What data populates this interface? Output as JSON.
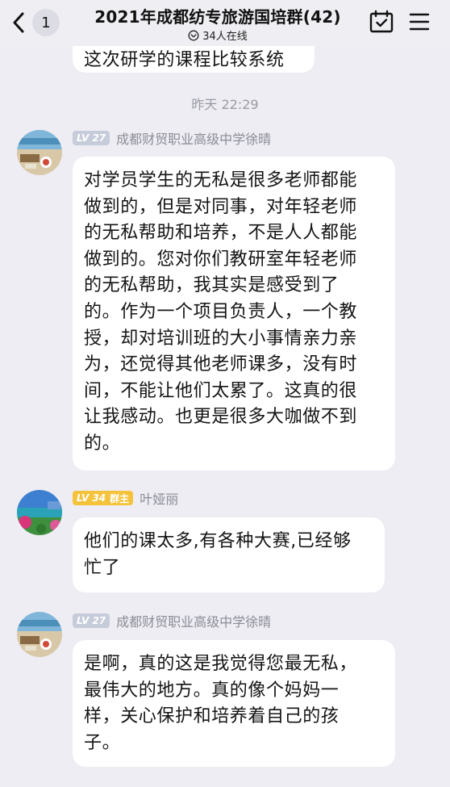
{
  "header": {
    "title": "2021年成都纺专旅游国培群(42)",
    "back_badge": "1",
    "online_text": "34人在线"
  },
  "partial_message": "这次研学的课程比较系统",
  "timestamp": "昨天 22:29",
  "messages": [
    {
      "level": "LV 27",
      "role": "",
      "sender": "成都财贸职业高级中学徐晴",
      "lines": [
        "对学员学生的无私是很多老师都能",
        "做到的，但是对同事，对年轻老师",
        "的无私帮助和培养，不是人人都能",
        "做到的。您对你们教研室年轻老师",
        "的无私帮助，我其实是感受到了",
        "的。作为一个项目负责人，一个教",
        "授，却对培训班的大小事情亲力亲",
        "为，还觉得其他老师课多，没有时",
        "间，不能让他们太累了。这真的很",
        "让我感动。也更是很多大咖做不到",
        "的。"
      ]
    },
    {
      "level": "LV 34",
      "role": "群主",
      "sender": "叶娅丽",
      "lines": [
        "他们的课太多,有各种大赛,已经够",
        "忙了"
      ]
    },
    {
      "level": "LV 27",
      "role": "",
      "sender": "成都财贸职业高级中学徐晴",
      "lines": [
        "是啊，真的这是我觉得您最无私，",
        "最伟大的地方。真的像个妈妈一",
        "样，关心保护和培养着自己的孩",
        "子。"
      ]
    }
  ],
  "colors": {
    "background": "#ededf3",
    "bubble": "#ffffff",
    "lv_badge": "#c6ccd9",
    "owner_badge": "#f5c33b",
    "sender_name": "#8c8c98"
  },
  "icons": [
    "back-arrow-icon",
    "online-status-icon",
    "calendar-check-icon",
    "menu-icon"
  ]
}
